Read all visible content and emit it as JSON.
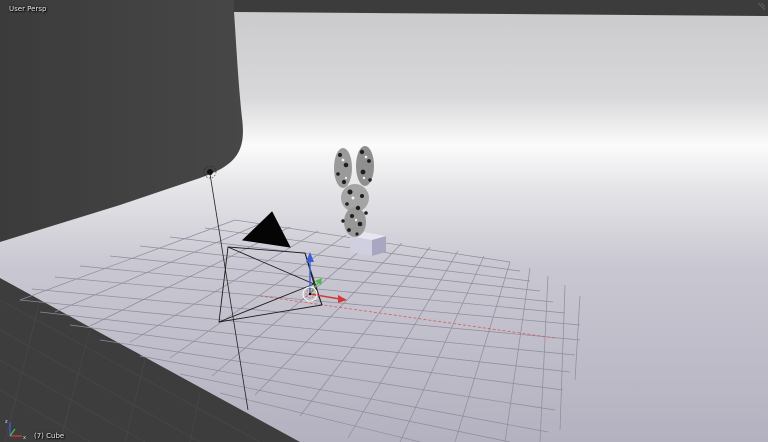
{
  "viewport": {
    "view_name": "User Persp",
    "object_label": "(7) Cube"
  },
  "icons": {
    "corner_grip": "viewport-split-corner-icon",
    "axis_gizmo": "view-axis-gizmo-icon",
    "transform_manipulator": "transform-manipulator-icon",
    "lamp": "lamp-icon",
    "camera": "camera-icon"
  },
  "colors": {
    "backdrop_shadow": "#3a3a3a",
    "backdrop_light": "#dcdcdf",
    "floor": "#b8b6c4",
    "grid_line": "#8d8a9a",
    "x_axis": "#d23a3a",
    "y_axis": "#4cb84c",
    "z_axis": "#3a5fd8"
  }
}
